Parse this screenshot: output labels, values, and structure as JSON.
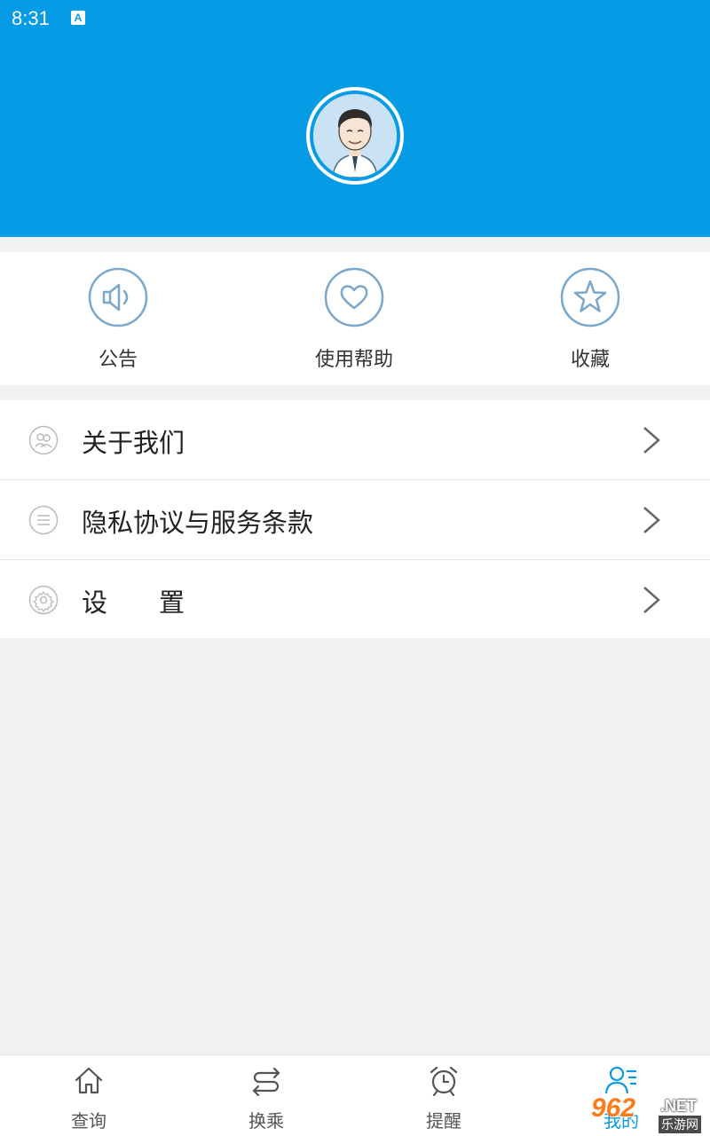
{
  "status_bar": {
    "time": "8:31",
    "indicator": "A"
  },
  "header": {
    "avatar_icon": "user-avatar-icon",
    "accent": "#059be5"
  },
  "quick_actions": [
    {
      "label": "公告",
      "icon": "speaker-icon"
    },
    {
      "label": "使用帮助",
      "icon": "heart-icon"
    },
    {
      "label": "收藏",
      "icon": "star-icon"
    }
  ],
  "menu": [
    {
      "label": "关于我们",
      "icon": "users-icon"
    },
    {
      "label": "隐私协议与服务条款",
      "icon": "list-icon"
    },
    {
      "label": "设　　置",
      "icon": "gear-icon"
    }
  ],
  "tabbar": [
    {
      "label": "查询",
      "icon": "home-icon"
    },
    {
      "label": "换乘",
      "icon": "transfer-icon"
    },
    {
      "label": "提醒",
      "icon": "alarm-icon"
    },
    {
      "label": "我的",
      "icon": "profile-icon",
      "active": true
    }
  ],
  "watermark": {
    "number": "962",
    "domain": ".NET",
    "cn_text": "乐游网"
  }
}
